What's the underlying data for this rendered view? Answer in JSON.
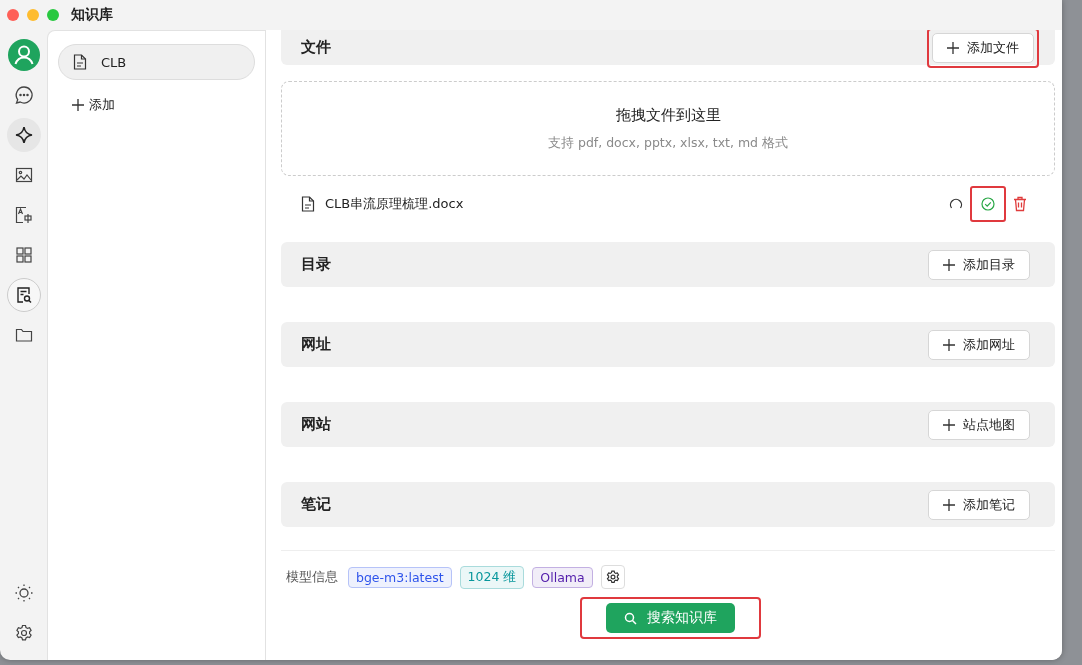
{
  "window": {
    "title": "知识库"
  },
  "rail": {
    "items": [
      {
        "selected": false,
        "hovered": false
      },
      {
        "selected": false,
        "hovered": false
      },
      {
        "selected": false,
        "hovered": true
      },
      {
        "selected": false,
        "hovered": false
      },
      {
        "selected": false,
        "hovered": false
      },
      {
        "selected": false,
        "hovered": false
      },
      {
        "selected": true,
        "hovered": false
      },
      {
        "selected": false,
        "hovered": false
      }
    ]
  },
  "knowledge_bases": {
    "items": [
      {
        "label": "CLB",
        "selected": true
      }
    ],
    "add_label": "添加"
  },
  "sections": [
    {
      "kind": "files",
      "title": "文件",
      "button": "添加文件",
      "highlighted": true,
      "dropzone": {
        "title": "拖拽文件到这里",
        "hint": "支持 pdf, docx, pptx, xlsx, txt, md 格式"
      },
      "files": [
        {
          "name": "CLB串流原理梳理.docx",
          "status_highlighted": true
        }
      ]
    },
    {
      "kind": "plain",
      "title": "目录",
      "button": "添加目录",
      "highlighted": false
    },
    {
      "kind": "plain",
      "title": "网址",
      "button": "添加网址",
      "highlighted": false
    },
    {
      "kind": "plain",
      "title": "网站",
      "button": "站点地图",
      "highlighted": false
    },
    {
      "kind": "plain",
      "title": "笔记",
      "button": "添加笔记",
      "highlighted": false
    }
  ],
  "footer": {
    "label": "模型信息",
    "tags": [
      {
        "text": "bge-m3:latest",
        "color": "#2f54eb"
      },
      {
        "text": "1024 维",
        "color": "#08979c"
      },
      {
        "text": "Ollama",
        "color": "#531dab"
      }
    ],
    "search_button": {
      "label": "搜索知识库",
      "highlighted": true
    }
  }
}
